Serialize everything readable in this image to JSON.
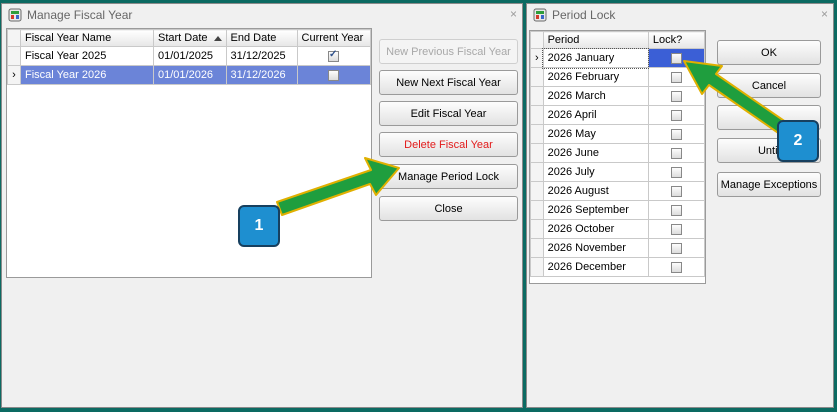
{
  "window1": {
    "title": "Manage Fiscal Year",
    "close_glyph": "×",
    "grid": {
      "columns": [
        "Fiscal Year Name",
        "Start Date",
        "End Date",
        "Current Year"
      ],
      "rows": [
        {
          "name": "Fiscal Year 2025",
          "start": "01/01/2025",
          "end": "31/12/2025",
          "current": true
        },
        {
          "name": "Fiscal Year 2026",
          "start": "01/01/2026",
          "end": "31/12/2026",
          "current": false
        }
      ],
      "row_indicator": "›"
    },
    "buttons": {
      "new_previous": "New Previous Fiscal Year",
      "new_next": "New Next Fiscal Year",
      "edit": "Edit Fiscal Year",
      "delete": "Delete Fiscal Year",
      "manage_period_lock": "Manage Period Lock",
      "close": "Close"
    }
  },
  "window2": {
    "title": "Period Lock",
    "close_glyph": "×",
    "grid": {
      "columns": [
        "Period",
        "Lock?"
      ],
      "rows": [
        {
          "period": "2026 January",
          "lock": false
        },
        {
          "period": "2026 February",
          "lock": false
        },
        {
          "period": "2026 March",
          "lock": false
        },
        {
          "period": "2026 April",
          "lock": false
        },
        {
          "period": "2026 May",
          "lock": false
        },
        {
          "period": "2026 June",
          "lock": false
        },
        {
          "period": "2026 July",
          "lock": false
        },
        {
          "period": "2026 August",
          "lock": false
        },
        {
          "period": "2026 September",
          "lock": false
        },
        {
          "period": "2026 October",
          "lock": false
        },
        {
          "period": "2026 November",
          "lock": false
        },
        {
          "period": "2026 December",
          "lock": false
        }
      ],
      "row_indicator": "›"
    },
    "buttons": {
      "ok": "OK",
      "cancel": "Cancel",
      "all": "All",
      "until": "Until",
      "manage_exceptions": "Manage Exceptions"
    }
  },
  "callouts": {
    "one": "1",
    "two": "2"
  },
  "colors": {
    "arrow_fill": "#1f9e3e",
    "arrow_stroke": "#e0b000",
    "callout": "#1e8fd0",
    "selection": "#6b84d8",
    "background": "#0c6a62"
  }
}
